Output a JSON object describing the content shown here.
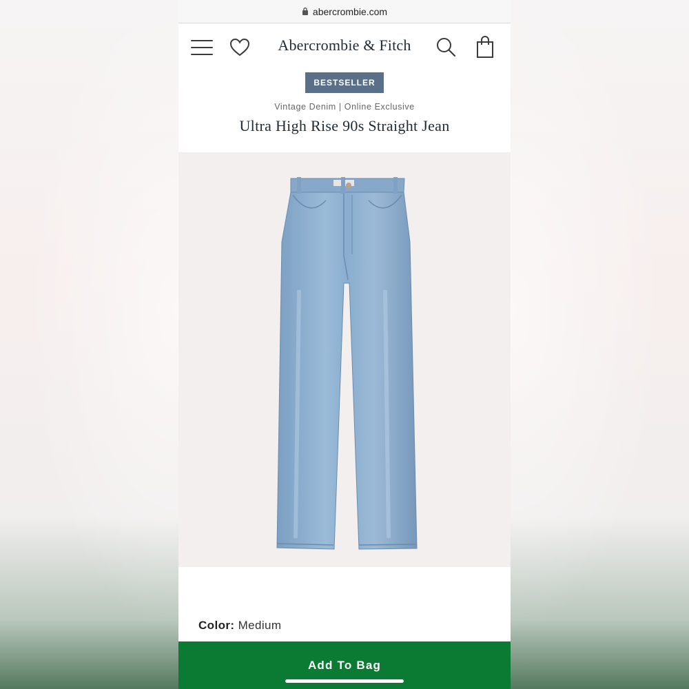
{
  "browser": {
    "url": "abercrombie.com",
    "lock_icon": "lock-icon"
  },
  "header": {
    "brand": "Abercrombie & Fitch",
    "icons": [
      "hamburger-menu-icon",
      "heart-icon",
      "search-icon",
      "shopping-bag-icon"
    ]
  },
  "product": {
    "badge": "BESTSELLER",
    "subtitle": "Vintage Denim | Online Exclusive",
    "title": "Ultra High Rise 90s Straight Jean",
    "image_alt_icon": "jeans-product-image",
    "color_label": "Color:",
    "color_value": "Medium"
  },
  "actions": {
    "add_to_bag": "Add To Bag"
  },
  "colors": {
    "badge_bg": "#5a7088",
    "button_bg": "#0b7a32",
    "brand_text": "#1f2a33",
    "denim": "#8fb0cf"
  }
}
